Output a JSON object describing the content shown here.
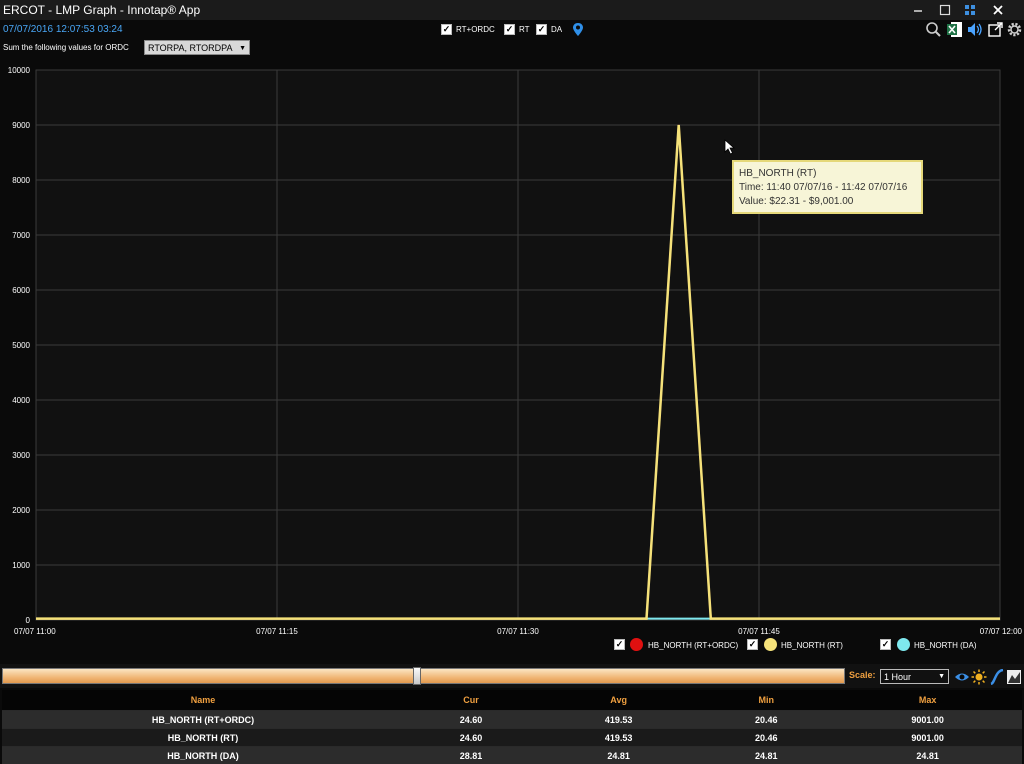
{
  "app": {
    "title": "ERCOT - LMP Graph - Innotap® App"
  },
  "window": {
    "minimize_icon": "minimize-icon",
    "maximize_icon": "maximize-icon",
    "snap_icon": "snap-layout-icon",
    "close_icon": "close-icon"
  },
  "header": {
    "datetime": "07/07/2016 12:07:53  03:24",
    "ordc_label": "Sum the following values for ORDC",
    "ordc_value": "RTORPA, RTORDPA",
    "toggles": [
      {
        "label": "RT+ORDC",
        "checked": true
      },
      {
        "label": "RT",
        "checked": true
      },
      {
        "label": "DA",
        "checked": true
      }
    ],
    "pin_icon": "map-pin-icon",
    "tool_icons": [
      "search-icon",
      "excel-export-icon",
      "speaker-icon",
      "popout-icon",
      "gear-icon"
    ]
  },
  "colors": {
    "rt_ordc": "#e01010",
    "rt": "#f5e27a",
    "da": "#7ee8ee",
    "accent": "#f0a040",
    "blue": "#49a6f5"
  },
  "chart_data": {
    "type": "line",
    "x_labels": [
      "07/07 11:00",
      "07/07 11:15",
      "07/07 11:30",
      "07/07 11:45",
      "07/07 12:00"
    ],
    "y_ticks": [
      0,
      1000,
      2000,
      3000,
      4000,
      5000,
      6000,
      7000,
      8000,
      9000,
      10000
    ],
    "ylim": [
      0,
      10000
    ],
    "grid": true,
    "legend_placement": "bottom-right",
    "series": [
      {
        "name": "HB_NORTH (RT+ORDC)",
        "color": "#e01010",
        "checked": true,
        "points": [
          [
            "11:00",
            24.6
          ],
          [
            "11:38",
            24.6
          ],
          [
            "11:40",
            9001.0
          ],
          [
            "11:42",
            24.6
          ],
          [
            "12:00",
            24.6
          ]
        ]
      },
      {
        "name": "HB_NORTH (RT)",
        "color": "#f5e27a",
        "checked": true,
        "points": [
          [
            "11:00",
            24.6
          ],
          [
            "11:38",
            24.6
          ],
          [
            "11:40",
            9001.0
          ],
          [
            "11:42",
            24.6
          ],
          [
            "12:00",
            24.6
          ]
        ]
      },
      {
        "name": "HB_NORTH (DA)",
        "color": "#7ee8ee",
        "checked": true,
        "points": [
          [
            "11:00",
            24.81
          ],
          [
            "12:00",
            24.81
          ]
        ]
      }
    ]
  },
  "tooltip": {
    "title": "HB_NORTH (RT)",
    "time": "Time: 11:40 07/07/16 - 11:42 07/07/16",
    "value": "Value: $22.31 - $9,001.00"
  },
  "scale": {
    "label": "Scale:",
    "value": "1 Hour",
    "icons": [
      "eye-icon",
      "sun-icon",
      "curve-icon",
      "chart-icon"
    ]
  },
  "table": {
    "headers": [
      "Name",
      "Cur",
      "Avg",
      "Min",
      "Max"
    ],
    "rows": [
      [
        "HB_NORTH (RT+ORDC)",
        "24.60",
        "419.53",
        "20.46",
        "9001.00"
      ],
      [
        "HB_NORTH (RT)",
        "24.60",
        "419.53",
        "20.46",
        "9001.00"
      ],
      [
        "HB_NORTH (DA)",
        "28.81",
        "24.81",
        "24.81",
        "24.81"
      ]
    ]
  }
}
